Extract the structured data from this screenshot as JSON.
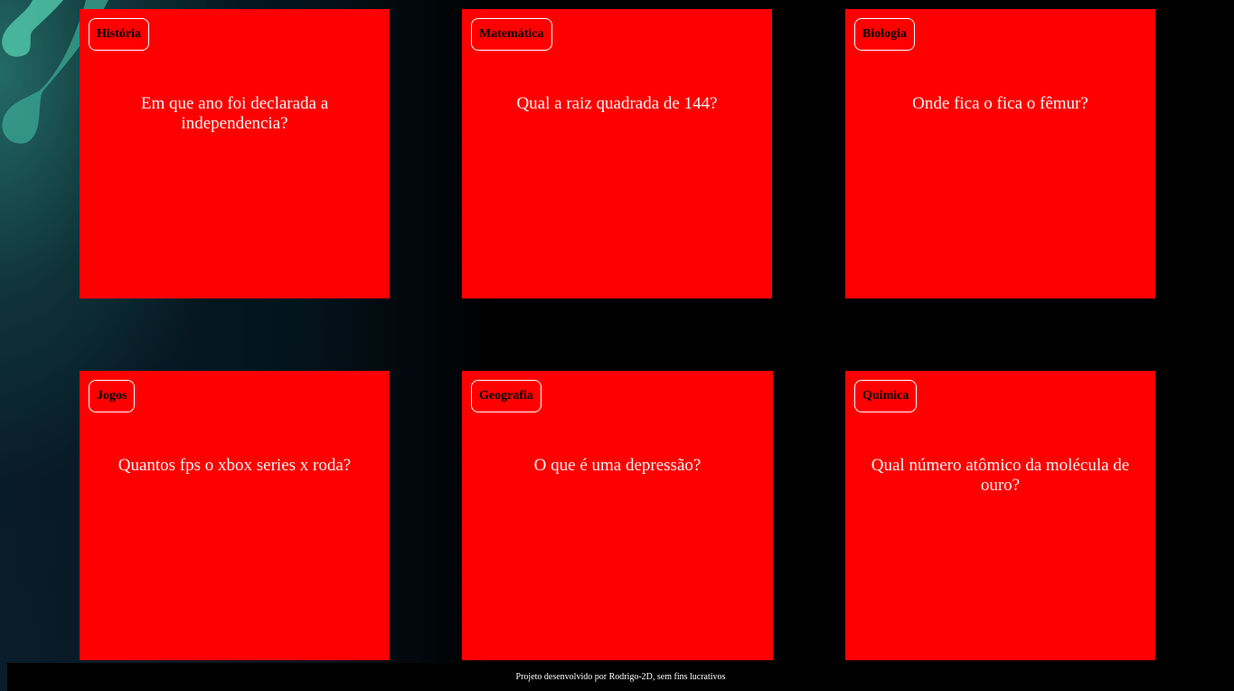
{
  "cards": [
    {
      "category": "História",
      "question": "Em que ano foi declarada a independencia?"
    },
    {
      "category": "Matemática",
      "question": "Qual a raiz quadrada de 144?"
    },
    {
      "category": "Biologia",
      "question": "Onde fica o fica o fêmur?"
    },
    {
      "category": "Jogos",
      "question": "Quantos fps o xbox series x roda?"
    },
    {
      "category": "Geografia",
      "question": "O que é uma depressão?"
    },
    {
      "category": "Quimica",
      "question": "Qual número atômico da molécula de ouro?"
    }
  ],
  "footer": {
    "text": "Projeto desenvolvido por Rodrigo-2D, sem fins lucrativos"
  },
  "colors": {
    "card": "#ff0000",
    "background": "#000000",
    "accent_swirl": "#4fc3a8"
  }
}
